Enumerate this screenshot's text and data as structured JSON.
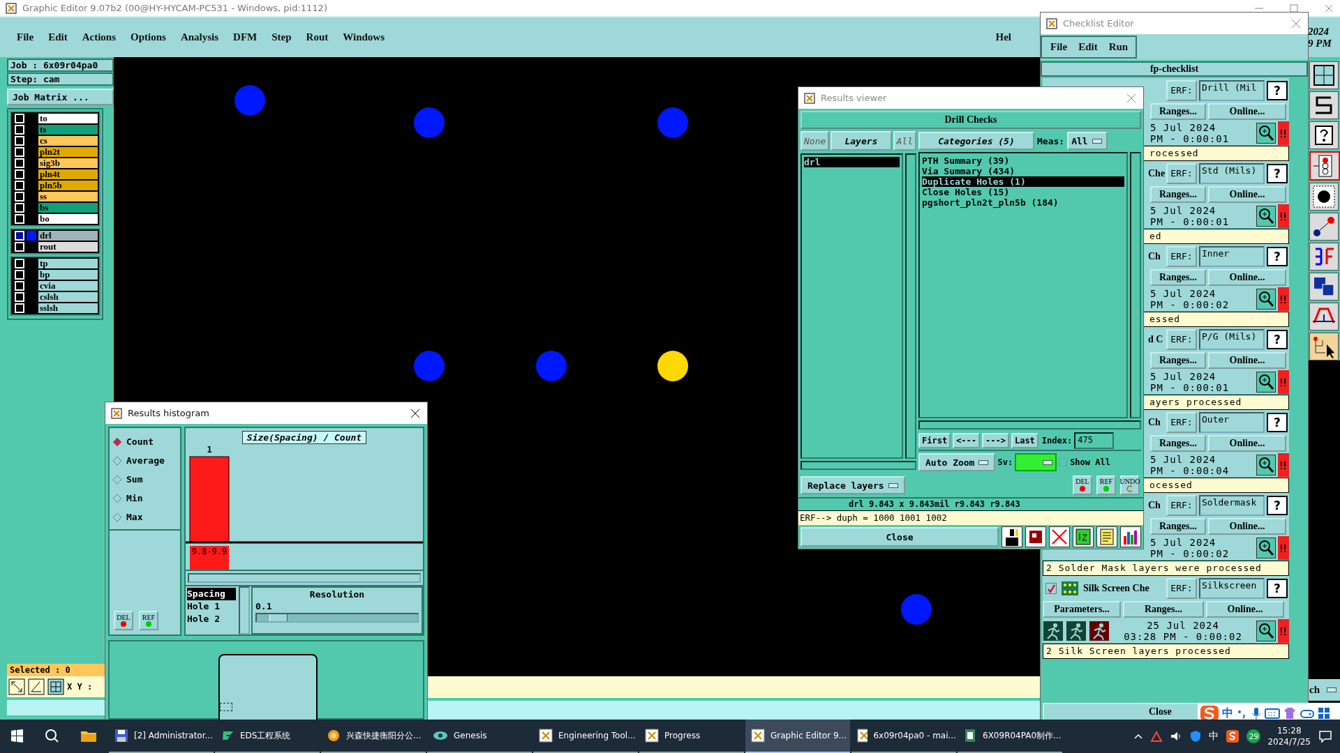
{
  "main_window": {
    "title": "Graphic Editor 9.07b2 (00@HY-HYCAM-PC531 - Windows, pid:1112)"
  },
  "menu": [
    "File",
    "Edit",
    "Actions",
    "Options",
    "Analysis",
    "DFM",
    "Step",
    "Rout",
    "Windows"
  ],
  "menu_fragment": "Hel",
  "clock_fragment": [
    "2024",
    "9 PM"
  ],
  "job": {
    "job": "Job : 6x09r04pa0",
    "step": "Step: cam",
    "matrix_button": "Job Matrix ..."
  },
  "layer_groups": [
    [
      {
        "name": "to",
        "color": "#ffffff",
        "selected": false
      },
      {
        "name": "ts",
        "color": "#12a07a",
        "selected": false
      },
      {
        "name": "cs",
        "color": "#ffc65a",
        "selected": false
      },
      {
        "name": "pln2t",
        "color": "#e0aa00",
        "selected": false
      },
      {
        "name": "sig3b",
        "color": "#ffc65a",
        "selected": false
      },
      {
        "name": "pln4t",
        "color": "#e0aa00",
        "selected": false
      },
      {
        "name": "pln5b",
        "color": "#e0aa00",
        "selected": false
      },
      {
        "name": "ss",
        "color": "#ffc65a",
        "selected": false
      },
      {
        "name": "bs",
        "color": "#12a07a",
        "selected": false
      },
      {
        "name": "bo",
        "color": "#ffffff",
        "selected": false
      }
    ],
    [
      {
        "name": "drl",
        "color": "#9fb4b8",
        "selected": true
      },
      {
        "name": "rout",
        "color": "#dcdcdc",
        "selected": false
      }
    ],
    [
      {
        "name": "tp",
        "color": "#9ed8d8",
        "selected": false
      },
      {
        "name": "bp",
        "color": "#9ed8d8",
        "selected": false
      },
      {
        "name": "cvia",
        "color": "#9ed8d8",
        "selected": false
      },
      {
        "name": "cslsh",
        "color": "#9ed8d8",
        "selected": false
      },
      {
        "name": "sslsh",
        "color": "#9ed8d8",
        "selected": false
      }
    ]
  ],
  "selected_count": "Selected : 0",
  "xy_label": "X Y :",
  "right_dropdown": "ch",
  "histogram": {
    "title": "Results histogram",
    "modes": [
      {
        "label": "Count",
        "selected": true
      },
      {
        "label": "Average",
        "selected": false
      },
      {
        "label": "Sum",
        "selected": false
      },
      {
        "label": "Min",
        "selected": false
      },
      {
        "label": "Max",
        "selected": false
      }
    ],
    "del": "DEL",
    "ref": "REF",
    "chart": {
      "title": "Size(Spacing) / Count",
      "bars": [
        {
          "count": "1",
          "category": "9.8-9.9"
        }
      ]
    },
    "fields": [
      {
        "label": "Spacing",
        "selected": true
      },
      {
        "label": "Hole 1",
        "selected": false
      },
      {
        "label": "Hole 2",
        "selected": false
      }
    ],
    "resolution": {
      "label": "Resolution",
      "value": "0.1",
      "level": 0.08
    }
  },
  "viewer": {
    "title": "Results viewer",
    "header": "Drill Checks",
    "layer_buttons": [
      {
        "label": "None",
        "disabled": true
      },
      {
        "label": "Layers",
        "disabled": false
      },
      {
        "label": "All",
        "disabled": true
      }
    ],
    "layers": [
      {
        "name": "drl",
        "selected": true
      }
    ],
    "replace": "Replace layers",
    "categories_button": "Categories (5)",
    "meas_label": "Meas:",
    "meas_value": "All",
    "categories": [
      {
        "label": "PTH Summary (39)",
        "selected": false
      },
      {
        "label": "Via Summary (434)",
        "selected": false
      },
      {
        "label": "Duplicate Holes (1)",
        "selected": true
      },
      {
        "label": "Close Holes (15)",
        "selected": false
      },
      {
        "label": "pgshort_pln2t_pln5b (184)",
        "selected": false
      }
    ],
    "nav": [
      "First",
      "<---",
      "--->",
      "Last"
    ],
    "index_label": "Index:",
    "index_value": "475",
    "auto_zoom": "Auto Zoom",
    "sv_label": "Sv:",
    "show_all": {
      "label": "Show All",
      "checked": false
    },
    "action_buttons": [
      "DEL",
      "REF",
      "UNDO"
    ],
    "info": "drl 9.843 x 9.843mil r9.843 r9.843",
    "erf": "ERF--> duph = 1000 1001 1002",
    "close": "Close"
  },
  "checklist": {
    "title": "Checklist Editor",
    "menu": [
      "File",
      "Edit",
      "Run"
    ],
    "name": "fp-checklist",
    "sections": [
      {
        "kind": "covered",
        "erf_label": "ERF:",
        "erf": "Drill (Mil",
        "help": "?",
        "ranges": "Ranges...",
        "online": "Online...",
        "date": "5 Jul 2024",
        "time": "PM - 0:00:01",
        "message": "rocessed"
      },
      {
        "kind": "covered",
        "name": "Che",
        "erf_label": "ERF:",
        "erf": "Std (Mils)",
        "help": "?",
        "ranges": "Ranges...",
        "online": "Online...",
        "date": "5 Jul 2024",
        "time": "PM - 0:00:01",
        "message": "ed"
      },
      {
        "kind": "covered",
        "name": "Ch",
        "erf_label": "ERF:",
        "erf": "Inner",
        "help": "?",
        "ranges": "Ranges...",
        "online": "Online...",
        "date": "5 Jul 2024",
        "time": "PM - 0:00:02",
        "message": "essed"
      },
      {
        "kind": "covered",
        "name": "d C",
        "erf_label": "ERF:",
        "erf": "P/G (Mils)",
        "help": "?",
        "ranges": "Ranges...",
        "online": "Online...",
        "date": "5 Jul 2024",
        "time": "PM - 0:00:01",
        "message": "ayers processed"
      },
      {
        "kind": "covered",
        "name": "Ch",
        "erf_label": "ERF:",
        "erf": "Outer",
        "help": "?",
        "ranges": "Ranges...",
        "online": "Online...",
        "date": "5 Jul 2024",
        "time": "PM - 0:00:04",
        "message": "ocessed"
      },
      {
        "kind": "covered_top",
        "name": "Ch",
        "erf_label": "ERF:",
        "erf": "Soldermask",
        "help": "?",
        "ranges": "Ranges...",
        "online": "Online...",
        "date": "5 Jul 2024",
        "time": "PM - 0:00:02",
        "message": "2 Solder Mask layers were processed"
      },
      {
        "kind": "full",
        "checked": true,
        "name": "Silk Screen Che",
        "erf_label": "ERF:",
        "erf": "Silkscreen",
        "help": "?",
        "parameters": "Parameters...",
        "ranges": "Ranges...",
        "online": "Online...",
        "date": "25 Jul 2024",
        "time": "03:28 PM - 0:00:02",
        "message": "2 Silk Screen layers processed"
      }
    ],
    "close": "Close"
  },
  "ime_bar": {
    "label": "中"
  },
  "taskbar": {
    "items": [
      {
        "kind": "disk",
        "label": "[2] Administrator...",
        "selected": false
      },
      {
        "kind": "logo",
        "label": "EDS工程系统",
        "selected": false
      },
      {
        "kind": "browser",
        "label": "兴森快捷衡阳分公...",
        "selected": false
      },
      {
        "kind": "eye",
        "label": "Genesis",
        "selected": false
      },
      {
        "kind": "app",
        "label": "Engineering Tool...",
        "selected": false
      },
      {
        "kind": "app",
        "label": "Progress",
        "selected": false
      },
      {
        "kind": "app",
        "label": "Graphic Editor 9...",
        "selected": true
      },
      {
        "kind": "app",
        "label": "6x09r04pa0 - mai...",
        "selected": false
      },
      {
        "kind": "doc",
        "label": "6X09R04PA0制作...",
        "selected": false
      }
    ],
    "tray": {
      "ime": "中",
      "badge": "29",
      "time": "15:28",
      "date": "2024/7/25"
    }
  }
}
